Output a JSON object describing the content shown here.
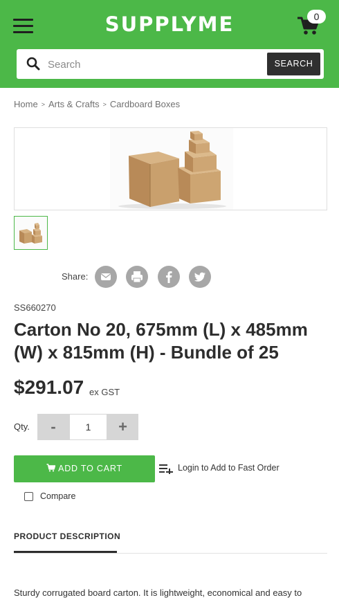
{
  "header": {
    "logo_text": "SUPPLYME",
    "cart_count": "0",
    "background_color": "#4cb848"
  },
  "search": {
    "placeholder": "Search",
    "button_label": "SEARCH"
  },
  "breadcrumb": {
    "items": [
      "Home",
      "Arts & Crafts",
      "Cardboard Boxes"
    ]
  },
  "product": {
    "sku": "SS660270",
    "title": "Carton No 20, 675mm (L) x 485mm (W) x 815mm (H) - Bundle of 25",
    "price": "$291.07",
    "tax_note": "ex GST"
  },
  "share": {
    "label": "Share:",
    "icons": [
      "email-icon",
      "print-icon",
      "facebook-icon",
      "twitter-icon"
    ]
  },
  "quantity": {
    "label": "Qty.",
    "minus_label": "-",
    "value": "1",
    "plus_label": "+"
  },
  "actions": {
    "add_to_cart_label": "ADD TO CART",
    "fast_order_label": "Login to Add to Fast Order",
    "compare_label": "Compare"
  },
  "tabs": {
    "description_label": "PRODUCT DESCRIPTION"
  },
  "description": {
    "text": "Sturdy corrugated board carton. It is lightweight, economical and easy to"
  }
}
